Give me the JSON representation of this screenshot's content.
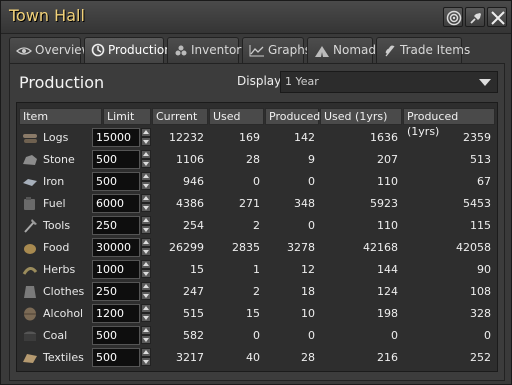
{
  "window": {
    "title": "Town Hall"
  },
  "tabs": [
    {
      "label": "Overview",
      "icon": "eye-icon"
    },
    {
      "label": "Production",
      "icon": "gear-icon",
      "active": true
    },
    {
      "label": "Inventory",
      "icon": "stack-icon"
    },
    {
      "label": "Graphs",
      "icon": "graph-icon"
    },
    {
      "label": "Nomads",
      "icon": "tent-icon"
    },
    {
      "label": "Trade Items",
      "icon": "wheat-icon"
    }
  ],
  "panel": {
    "title": "Production",
    "display_label": "Display",
    "display_value": "1 Year"
  },
  "table": {
    "headers": [
      "Item",
      "Limit",
      "Current",
      "Used",
      "Produced",
      "Used (1yrs)",
      "Produced (1yrs)"
    ],
    "rows": [
      {
        "item": "Logs",
        "limit": "15000",
        "current": "12232",
        "used": "169",
        "produced": "142",
        "used_1yrs": "1636",
        "produced_1yrs": "2359"
      },
      {
        "item": "Stone",
        "limit": "500",
        "current": "1106",
        "used": "28",
        "produced": "9",
        "used_1yrs": "207",
        "produced_1yrs": "513"
      },
      {
        "item": "Iron",
        "limit": "500",
        "current": "946",
        "used": "0",
        "produced": "0",
        "used_1yrs": "110",
        "produced_1yrs": "67"
      },
      {
        "item": "Fuel",
        "limit": "6000",
        "current": "4386",
        "used": "271",
        "produced": "348",
        "used_1yrs": "5923",
        "produced_1yrs": "5453"
      },
      {
        "item": "Tools",
        "limit": "250",
        "current": "254",
        "used": "2",
        "produced": "0",
        "used_1yrs": "110",
        "produced_1yrs": "115"
      },
      {
        "item": "Food",
        "limit": "30000",
        "current": "26299",
        "used": "2835",
        "produced": "3278",
        "used_1yrs": "42168",
        "produced_1yrs": "42058"
      },
      {
        "item": "Herbs",
        "limit": "1000",
        "current": "15",
        "used": "1",
        "produced": "12",
        "used_1yrs": "144",
        "produced_1yrs": "90"
      },
      {
        "item": "Clothes",
        "limit": "250",
        "current": "247",
        "used": "2",
        "produced": "18",
        "used_1yrs": "124",
        "produced_1yrs": "108"
      },
      {
        "item": "Alcohol",
        "limit": "1200",
        "current": "515",
        "used": "15",
        "produced": "10",
        "used_1yrs": "198",
        "produced_1yrs": "328"
      },
      {
        "item": "Coal",
        "limit": "500",
        "current": "582",
        "used": "0",
        "produced": "0",
        "used_1yrs": "0",
        "produced_1yrs": "0"
      },
      {
        "item": "Textiles",
        "limit": "500",
        "current": "3217",
        "used": "40",
        "produced": "28",
        "used_1yrs": "216",
        "produced_1yrs": "252"
      }
    ]
  },
  "colors": {
    "title": "#f2d27a",
    "background": "#3a3a3a",
    "cell_bg": "#2e2e2e"
  }
}
